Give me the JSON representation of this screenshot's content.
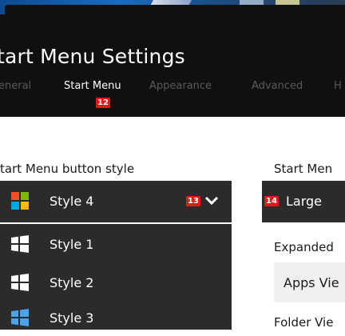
{
  "window": {
    "title": "tart Menu Settings"
  },
  "tabs": [
    {
      "label": "eneral",
      "active": false
    },
    {
      "label": "Start Menu",
      "active": true
    },
    {
      "label": "Appearance",
      "active": false
    },
    {
      "label": "Advanced",
      "active": false
    },
    {
      "label": "H",
      "active": false
    }
  ],
  "badges": {
    "tab": "12",
    "dropdown": "13",
    "size": "14"
  },
  "button_style": {
    "label": "tart Menu button style",
    "selected": "Style 4",
    "options": [
      "Style 1",
      "Style 2",
      "Style 3"
    ]
  },
  "menu_size": {
    "label": "Start Men",
    "value": "Large"
  },
  "expanded": {
    "label": "Expanded",
    "value": "Apps Vie"
  },
  "folder_view": {
    "label": "Folder Vie"
  },
  "colors": {
    "header_bg": "#101010",
    "panel_bg": "#2b2b2b",
    "badge": "#e01818",
    "accent_blue": "#4aa3ef"
  }
}
